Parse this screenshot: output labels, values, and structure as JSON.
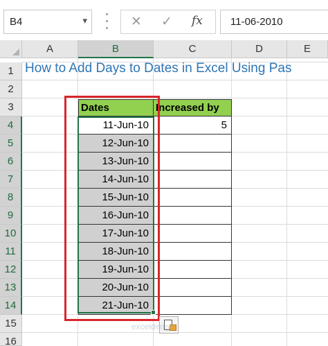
{
  "name_box": "B4",
  "formula_value": "11-06-2010",
  "formula_buttons": {
    "cancel_icon": "cancel-x-icon",
    "enter_icon": "check-icon",
    "function_label": "fx"
  },
  "columns": [
    "A",
    "B",
    "C",
    "D",
    "E"
  ],
  "rows": [
    "1",
    "2",
    "3",
    "4",
    "5",
    "6",
    "7",
    "8",
    "9",
    "10",
    "11",
    "12",
    "13",
    "14",
    "15",
    "16"
  ],
  "title": "How to Add  Days to Dates in Excel Using Pas",
  "table": {
    "header_dates": "Dates",
    "header_increase": "Increased by",
    "dates": [
      "11-Jun-10",
      "12-Jun-10",
      "13-Jun-10",
      "14-Jun-10",
      "15-Jun-10",
      "16-Jun-10",
      "17-Jun-10",
      "18-Jun-10",
      "19-Jun-10",
      "20-Jun-10",
      "21-Jun-10"
    ],
    "increase": [
      "5",
      "",
      "",
      "",
      "",
      "",
      "",
      "",
      "",
      "",
      ""
    ]
  },
  "watermark": "exceldemy",
  "colors": {
    "header_fill": "#92d050",
    "selection": "#217346",
    "highlight_box": "#d9262b",
    "title_text": "#2e75b6",
    "shaded_cells": "#d0d0d0"
  }
}
